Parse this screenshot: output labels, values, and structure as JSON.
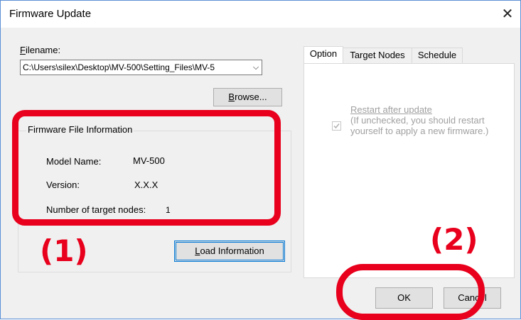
{
  "window": {
    "title": "Firmware Update",
    "close_glyph": "✕"
  },
  "filename": {
    "label_underline": "F",
    "label_rest": "ilename:",
    "value": "C:\\Users\\silex\\Desktop\\MV-500\\Setting_Files\\MV-5",
    "arrow_glyph": "⌵"
  },
  "buttons": {
    "browse_underline": "B",
    "browse_rest": "rowse...",
    "load_underline": "L",
    "load_rest": "oad Information",
    "ok": "OK",
    "cancel": "Cancel"
  },
  "firmware_info": {
    "title": "Firmware File Information",
    "model_label": "Model Name:",
    "model_value": "MV-500",
    "version_label": "Version:",
    "version_value": "X.X.X",
    "nodes_label": "Number of target nodes:",
    "nodes_value": "1"
  },
  "tabs": [
    {
      "label": "Option"
    },
    {
      "label": "Target Nodes"
    },
    {
      "label": "Schedule"
    }
  ],
  "option": {
    "restart_label": "Restart after update",
    "restart_note": "(If unchecked, you should restart yourself to apply a new firmware.)",
    "checked": true
  },
  "annotations": {
    "label1": "(1)",
    "label2": "(2)",
    "color": "#e8001c"
  }
}
